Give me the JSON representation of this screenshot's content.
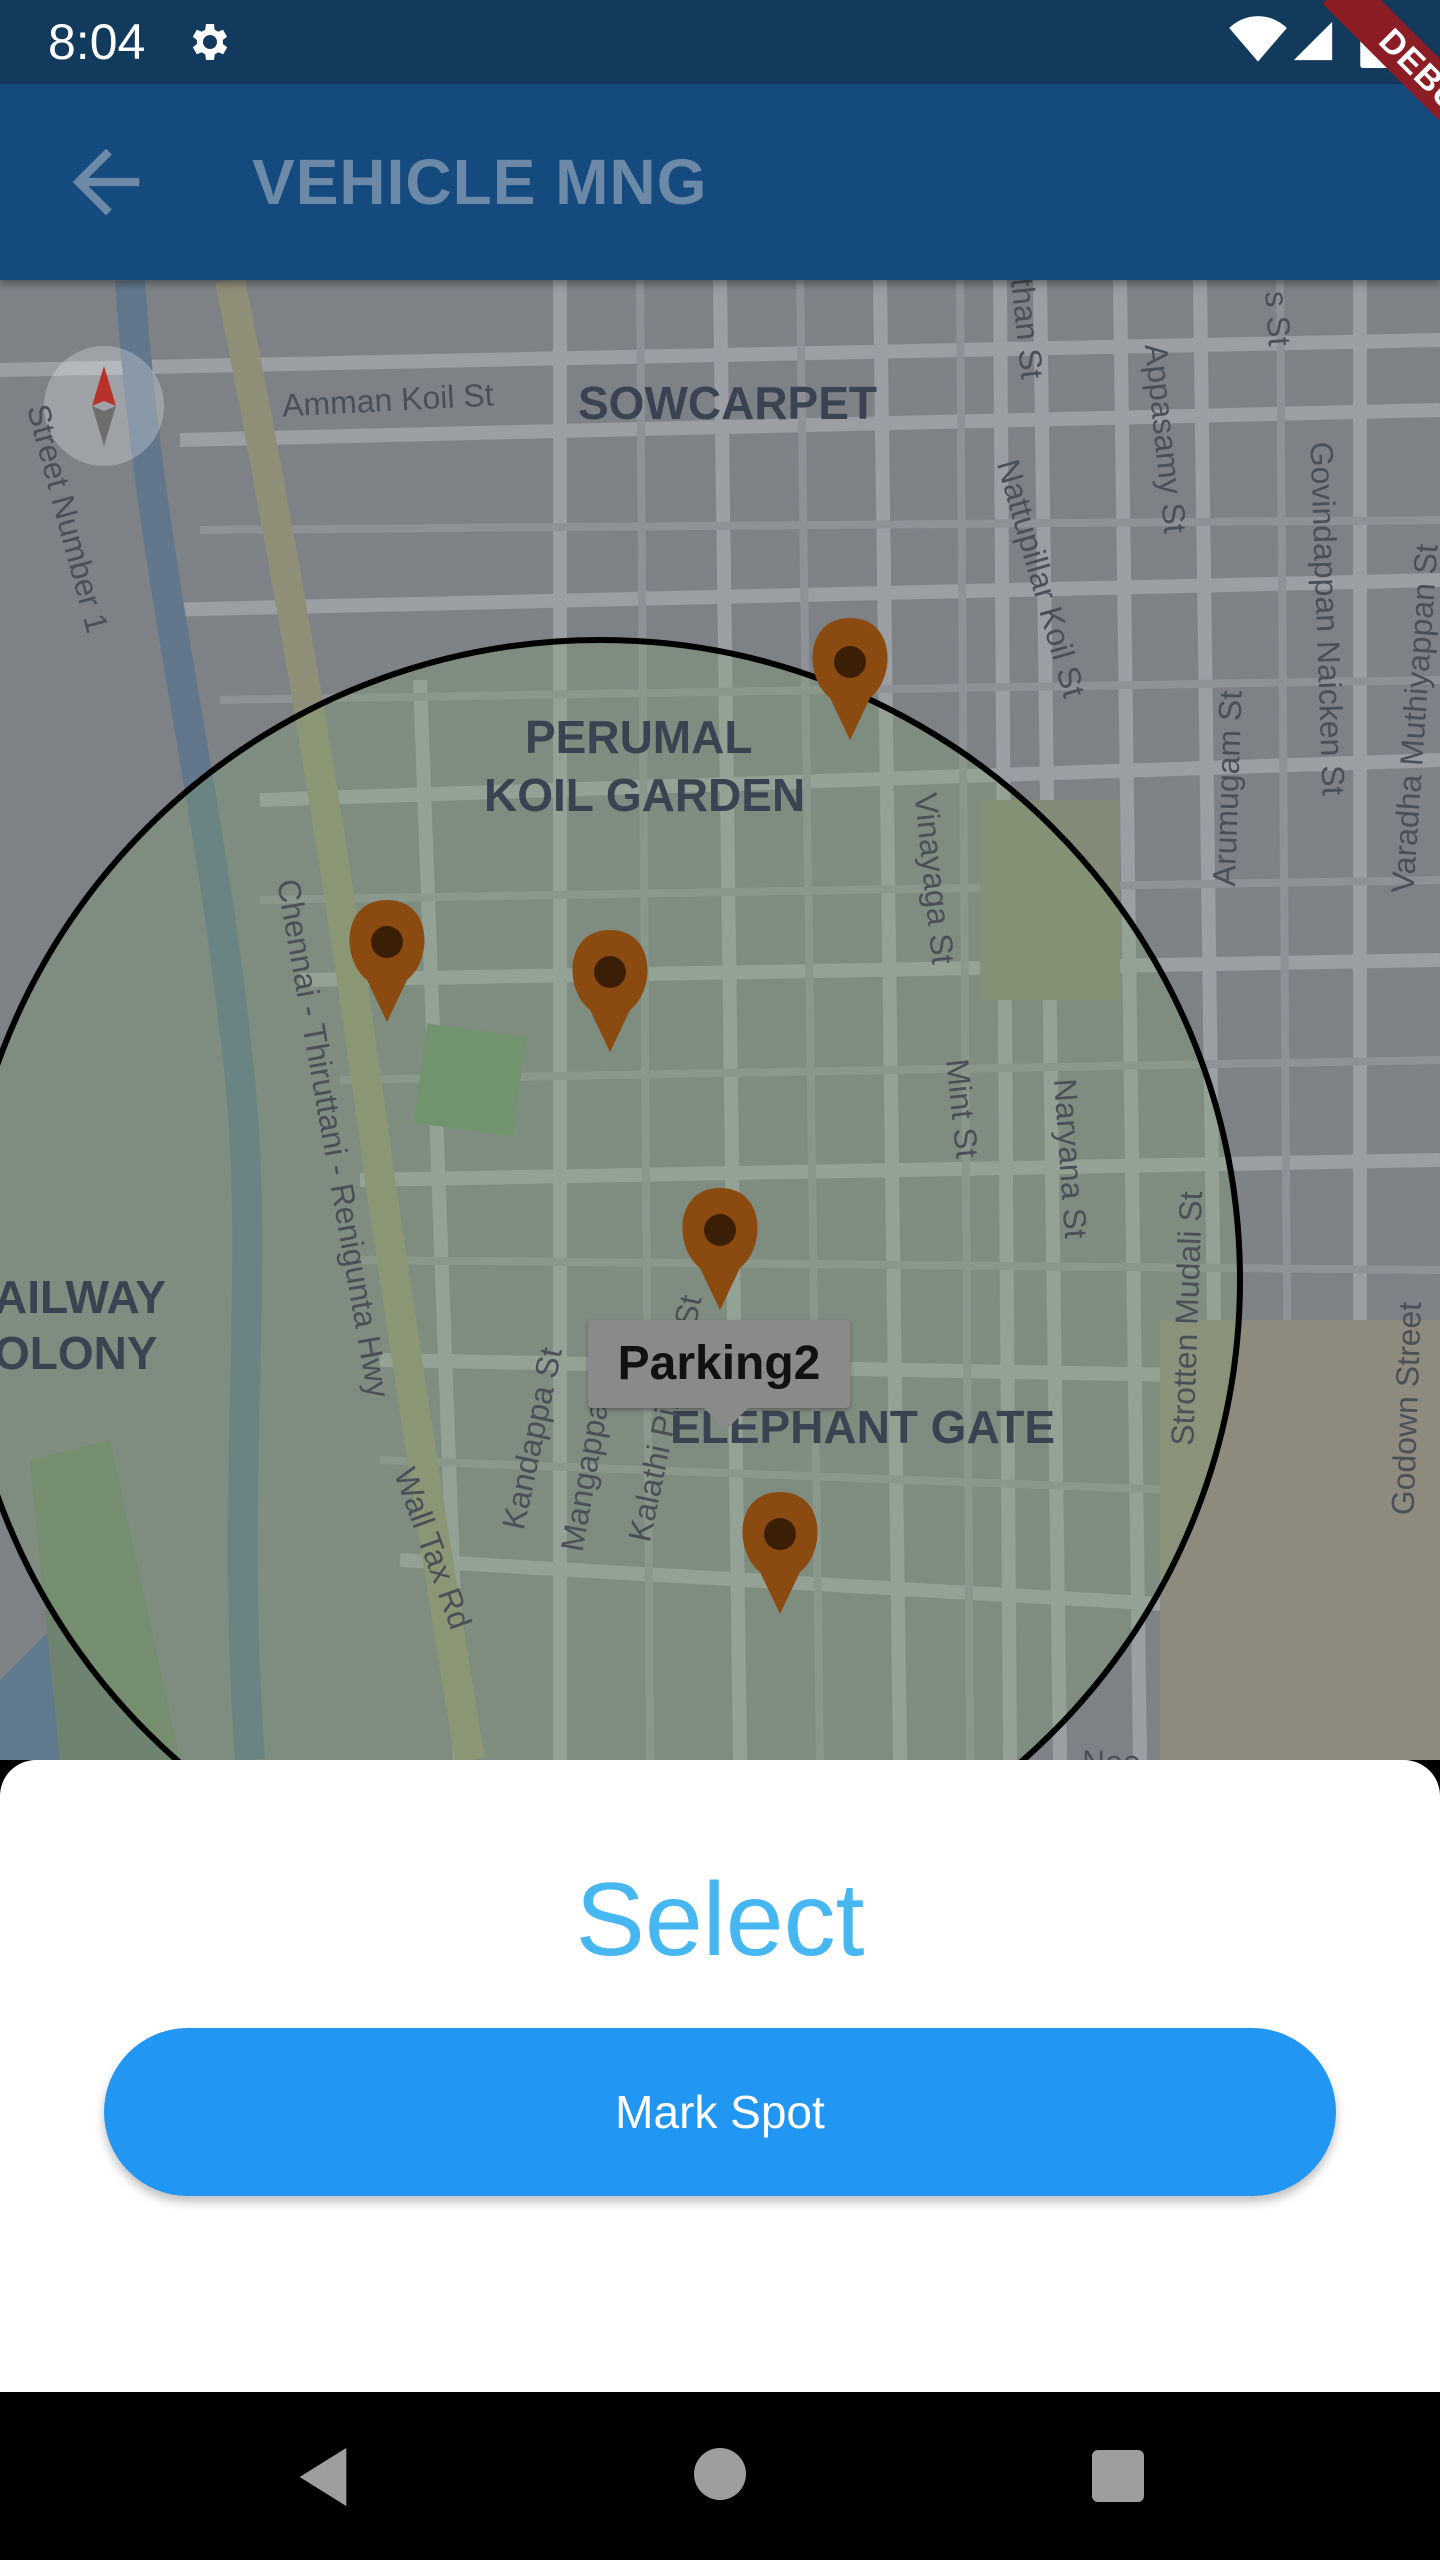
{
  "status_bar": {
    "time": "8:04",
    "icons": [
      "gear-icon",
      "wifi-icon",
      "signal-icon",
      "battery-icon"
    ]
  },
  "debug_banner": "DEBUG",
  "app_bar": {
    "title": "VEHICLE MNG",
    "back_icon": "arrow-left-icon",
    "color": "#154a7e"
  },
  "map": {
    "area_labels": {
      "sowcarpet": "SOWCARPET",
      "perumal_line1": "PERUMAL",
      "perumal_line2": "KOIL GARDEN",
      "railway_line1": "AILWAY",
      "railway_line2": "OLONY",
      "elephant_gate": "ELEPHANT GATE"
    },
    "street_labels": {
      "amman_koil": "Amman Koil St",
      "street_number_1": "Street Number 1",
      "than_st": "than St",
      "s_st": "s St",
      "appasamy": "Appasamy St",
      "nattupillar": "Nattupillar Koil St",
      "govindappan": "Govindappan Naicken St",
      "varadha": "Varadha Muthiyappan St",
      "arumugam": "Arumugam St",
      "vinayaga": "Vinayaga St",
      "chennai_hwy": "Chennai - Thiruttani - Renigunta Hwy",
      "mint": "Mint St",
      "naryana": "Naryana St",
      "strotten": "Strotten Mudali St",
      "godown": "Godown Street",
      "kandappa": "Kandappa St",
      "mangappan": "Mangappan St",
      "kalathi": "Kalathi Pillayar St",
      "wall_tax": "Wall Tax Rd",
      "nee": "Nee"
    },
    "info_window": "Parking2",
    "marker_color": "#8b4a0f",
    "circle_stroke": "#000000"
  },
  "sheet": {
    "title": "Select",
    "title_color": "#46b7f1",
    "button_label": "Mark Spot",
    "button_color": "#2196f3"
  },
  "nav_bar": {
    "icons": [
      "nav-back-icon",
      "nav-home-icon",
      "nav-recent-icon"
    ]
  }
}
